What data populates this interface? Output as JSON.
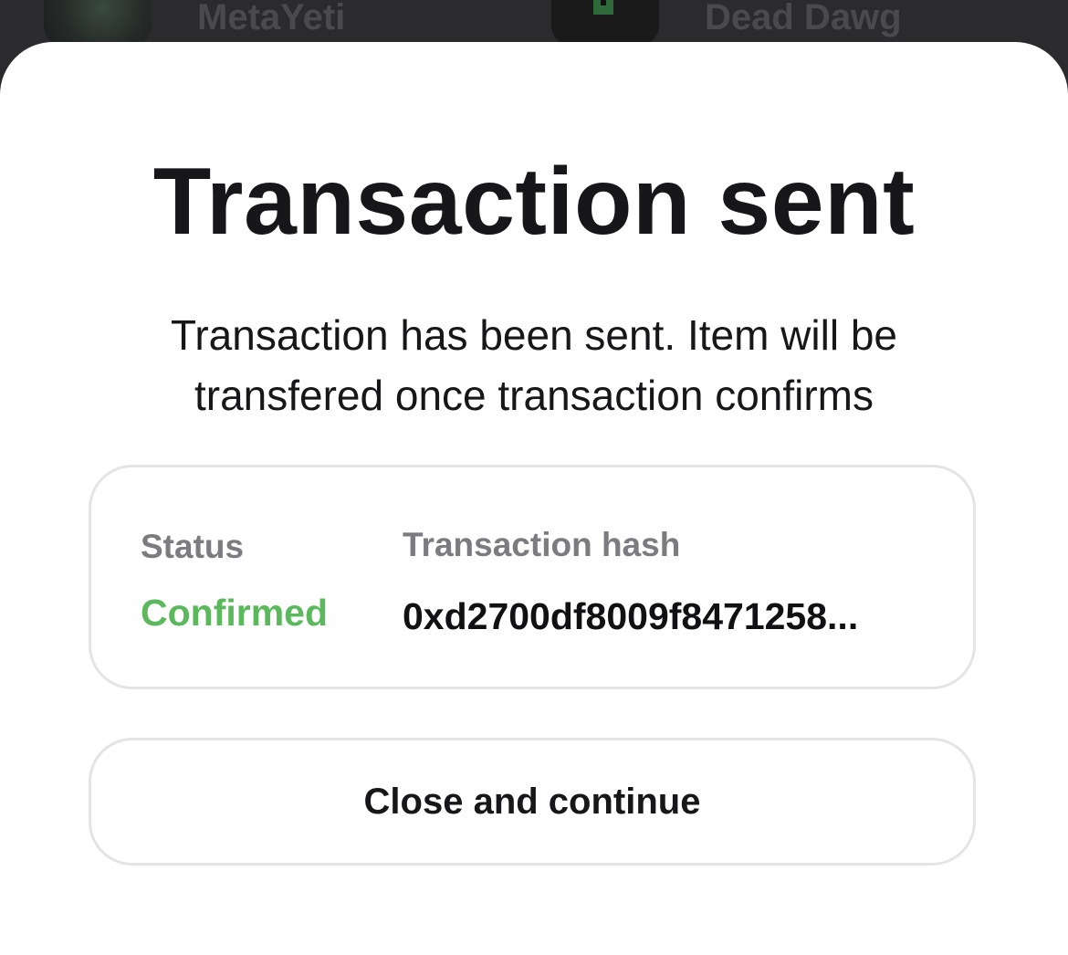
{
  "background": {
    "items": [
      {
        "name": "MetaYeti",
        "icon": "yeti-nft-thumbnail"
      },
      {
        "name": "Dead Dawg",
        "icon": "lock-nft-thumbnail"
      }
    ]
  },
  "modal": {
    "title": "Transaction sent",
    "message": "Transaction has been sent. Item will be transfered once transaction confirms",
    "status_label": "Status",
    "status_value": "Confirmed",
    "hash_label": "Transaction hash",
    "hash_value": "0xd2700df8009f8471258...",
    "close_label": "Close and continue"
  },
  "colors": {
    "status_confirmed": "#5cb85c",
    "backdrop": "#2b2b2e",
    "sheet": "#ffffff",
    "border": "#e4e4e6"
  }
}
